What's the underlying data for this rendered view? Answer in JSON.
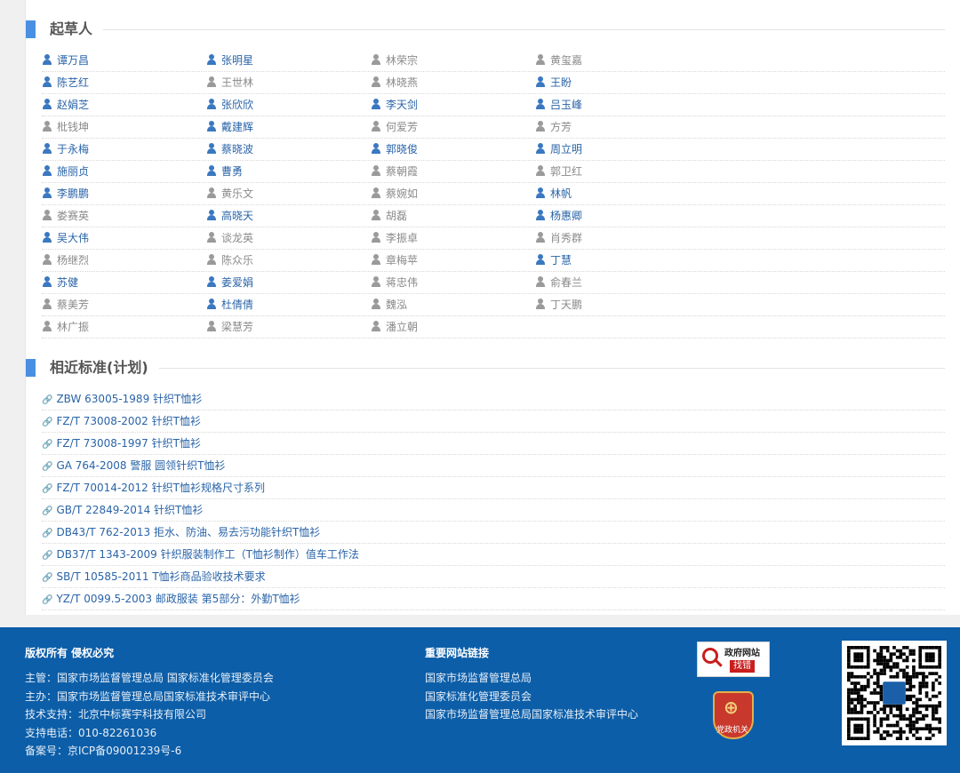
{
  "sections": {
    "drafters_title": "起草人",
    "related_title": "相近标准(计划)"
  },
  "drafters": [
    [
      {
        "name": "谭万昌",
        "active": true
      },
      {
        "name": "张明星",
        "active": true
      },
      {
        "name": "林荣宗",
        "active": false
      },
      {
        "name": "黄玺嘉",
        "active": false
      }
    ],
    [
      {
        "name": "陈艺红",
        "active": true
      },
      {
        "name": "王世林",
        "active": false
      },
      {
        "name": "林晓燕",
        "active": false
      },
      {
        "name": "王盼",
        "active": true
      }
    ],
    [
      {
        "name": "赵娟芝",
        "active": true
      },
      {
        "name": "张欣欣",
        "active": true
      },
      {
        "name": "李天剑",
        "active": true
      },
      {
        "name": "吕玉峰",
        "active": true
      }
    ],
    [
      {
        "name": "枇钱坤",
        "active": false
      },
      {
        "name": "戴建辉",
        "active": true
      },
      {
        "name": "何爱芳",
        "active": false
      },
      {
        "name": "方芳",
        "active": false
      }
    ],
    [
      {
        "name": "于永梅",
        "active": true
      },
      {
        "name": "蔡晓波",
        "active": true
      },
      {
        "name": "郭晓俊",
        "active": true
      },
      {
        "name": "周立明",
        "active": true
      }
    ],
    [
      {
        "name": "施丽贞",
        "active": true
      },
      {
        "name": "曹勇",
        "active": true
      },
      {
        "name": "蔡朝霞",
        "active": false
      },
      {
        "name": "郭卫红",
        "active": false
      }
    ],
    [
      {
        "name": "李鹏鹏",
        "active": true
      },
      {
        "name": "黄乐文",
        "active": false
      },
      {
        "name": "蔡婉如",
        "active": false
      },
      {
        "name": "林帆",
        "active": true
      }
    ],
    [
      {
        "name": "娄赛英",
        "active": false
      },
      {
        "name": "高晓天",
        "active": true
      },
      {
        "name": "胡磊",
        "active": false
      },
      {
        "name": "杨惠卿",
        "active": true
      }
    ],
    [
      {
        "name": "吴大伟",
        "active": true
      },
      {
        "name": "谈龙英",
        "active": false
      },
      {
        "name": "李振卓",
        "active": false
      },
      {
        "name": "肖秀群",
        "active": false
      }
    ],
    [
      {
        "name": "杨继烈",
        "active": false
      },
      {
        "name": "陈众乐",
        "active": false
      },
      {
        "name": "章梅苹",
        "active": false
      },
      {
        "name": "丁慧",
        "active": true
      }
    ],
    [
      {
        "name": "苏健",
        "active": true
      },
      {
        "name": "姜爱娟",
        "active": true
      },
      {
        "name": "蒋忠伟",
        "active": false
      },
      {
        "name": "俞春兰",
        "active": false
      }
    ],
    [
      {
        "name": "蔡美芳",
        "active": false
      },
      {
        "name": "杜倩倩",
        "active": true
      },
      {
        "name": "魏泓",
        "active": false
      },
      {
        "name": "丁天鹏",
        "active": false
      }
    ],
    [
      {
        "name": "林广振",
        "active": false
      },
      {
        "name": "梁慧芳",
        "active": false
      },
      {
        "name": "潘立朝",
        "active": false
      }
    ]
  ],
  "related_standards": [
    "ZBW 63005-1989  针织T恤衫",
    "FZ/T 73008-2002  针织T恤衫",
    "FZ/T 73008-1997  针织T恤衫",
    "GA 764-2008  警服 圆领针织T恤衫",
    "FZ/T 70014-2012  针织T恤衫规格尺寸系列",
    "GB/T 22849-2014  针织T恤衫",
    "DB43/T 762-2013  拒水、防油、易去污功能针织T恤衫",
    "DB37/T 1343-2009  针织服装制作工（T恤衫制作）值车工作法",
    "SB/T 10585-2011  T恤衫商品验收技术要求",
    "YZ/T 0099.5-2003  邮政服装 第5部分：外勤T恤衫"
  ],
  "footer": {
    "copyright_title": "版权所有 侵权必究",
    "lines": [
      "主管：国家市场监督管理总局 国家标准化管理委员会",
      "主办：国家市场监督管理总局国家标准技术审评中心",
      "技术支持：北京中标赛宇科技有限公司",
      "支持电话：010-82261036",
      "备案号：京ICP备09001239号-6"
    ],
    "links_title": "重要网站链接",
    "links": [
      "国家市场监督管理总局",
      "国家标准化管理委员会",
      "国家市场监督管理总局国家标准技术审评中心"
    ],
    "gov_badge_text": "政府网站",
    "gov_badge_sub": "找错",
    "party_badge_label": "党政机关"
  },
  "icons": {
    "person": "person-icon",
    "link": "link-icon"
  },
  "colors": {
    "accent": "#4a90e2",
    "link": "#2a64a8",
    "footer_bg": "#0c5ea8"
  }
}
